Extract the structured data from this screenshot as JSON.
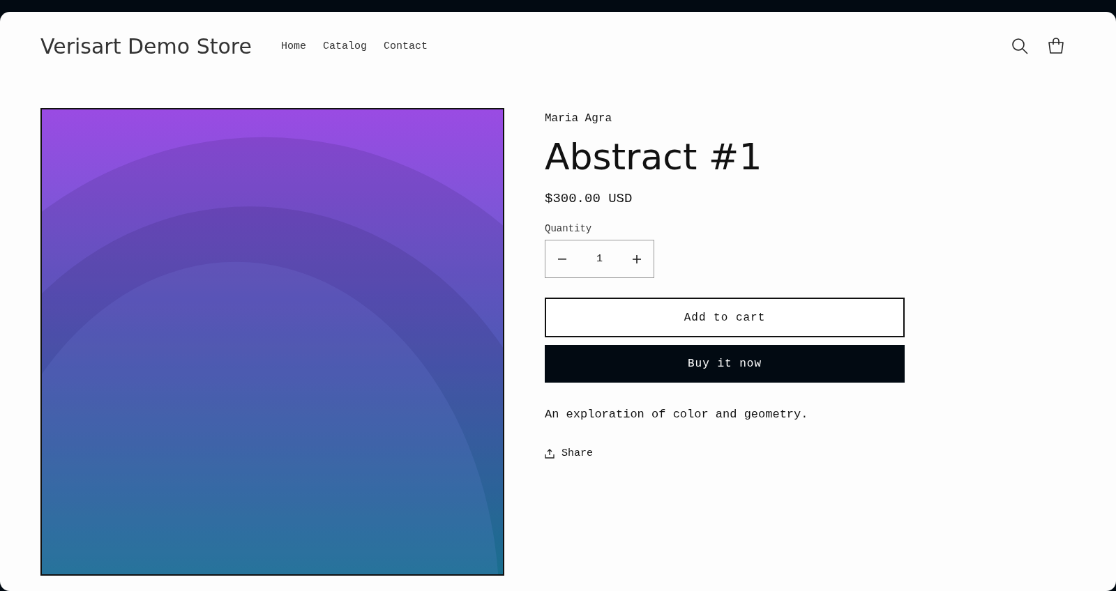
{
  "header": {
    "store_name": "Verisart Demo Store",
    "nav": [
      {
        "label": "Home"
      },
      {
        "label": "Catalog"
      },
      {
        "label": "Contact"
      }
    ]
  },
  "product": {
    "artist": "Maria Agra",
    "title": "Abstract #1",
    "price": "$300.00 USD",
    "quantity_label": "Quantity",
    "quantity": "1",
    "add_to_cart": "Add to cart",
    "buy_now": "Buy it now",
    "description": "An exploration of color and geometry.",
    "share": "Share"
  }
}
